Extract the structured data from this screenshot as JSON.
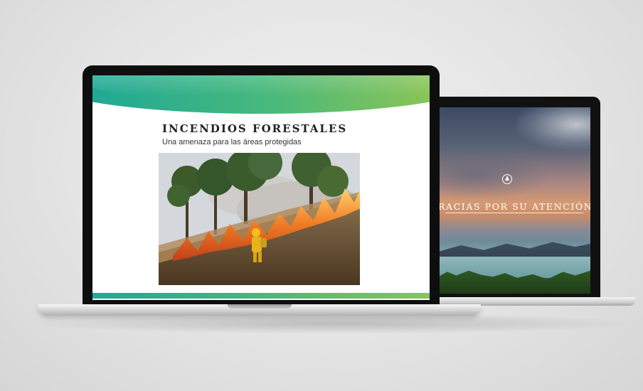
{
  "scene": {
    "description_colors": {
      "accent_start": "#1fa995",
      "accent_end": "#8ac456"
    }
  },
  "front_slide": {
    "title": "INCENDIOS FORESTALES",
    "subtitle": "Una amenaza para las áreas protegidas",
    "photo_icon": "wildfire-photo"
  },
  "back_slide": {
    "icon": "compass-icon",
    "thanks_text": "RACIAS POR SU ATENCIÓN!"
  }
}
